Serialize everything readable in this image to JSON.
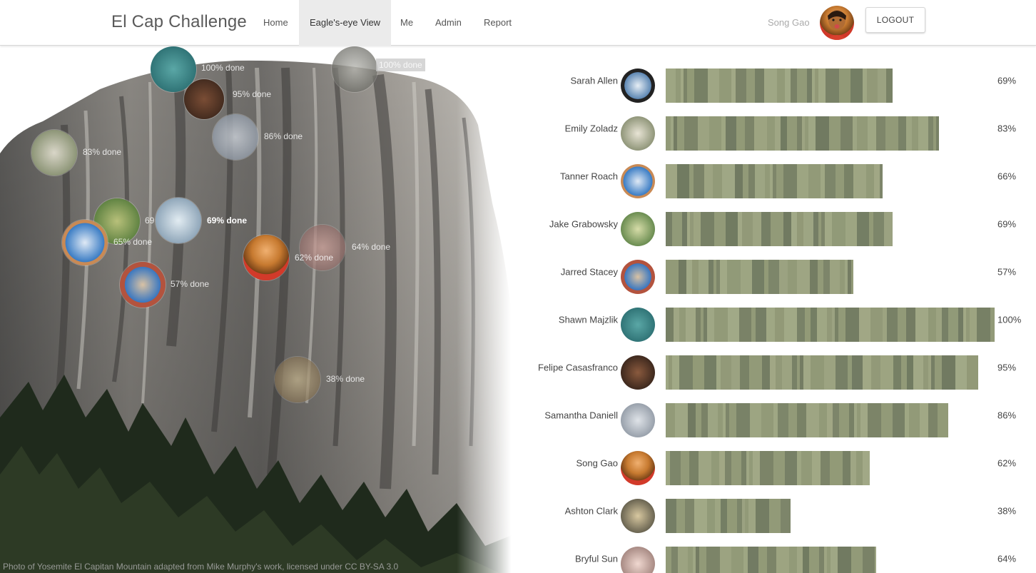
{
  "app": {
    "title": "El Cap Challenge"
  },
  "nav": {
    "items": [
      {
        "label": "Home",
        "active": false
      },
      {
        "label": "Eagle's-eye View",
        "active": true
      },
      {
        "label": "Me",
        "active": false
      },
      {
        "label": "Admin",
        "active": false
      },
      {
        "label": "Report",
        "active": false
      }
    ]
  },
  "user": {
    "name": "Song Gao",
    "logout_label": "LOGOUT"
  },
  "mountain": {
    "credit": "Photo of Yosemite El Capitan Mountain adapted from Mike Murphy's work, licensed under CC BY-SA 3.0",
    "markers": [
      {
        "label": "100% done"
      },
      {
        "label": "100% done"
      },
      {
        "label": "95% done"
      },
      {
        "label": "86% done"
      },
      {
        "label": "83% done"
      },
      {
        "label": "69"
      },
      {
        "label": "69% done"
      },
      {
        "label": "65% done"
      },
      {
        "label": "64% done"
      },
      {
        "label": "62% done"
      },
      {
        "label": "57% done"
      },
      {
        "label": "38% done"
      }
    ]
  },
  "leaderboard": [
    {
      "name": "Sarah Allen",
      "percent_label": "69%",
      "progress": 69
    },
    {
      "name": "Emily Zoladz",
      "percent_label": "83%",
      "progress": 83
    },
    {
      "name": "Tanner Roach",
      "percent_label": "66%",
      "progress": 66
    },
    {
      "name": "Jake Grabowsky",
      "percent_label": "69%",
      "progress": 69
    },
    {
      "name": "Jarred Stacey",
      "percent_label": "57%",
      "progress": 57
    },
    {
      "name": "Shawn Majzlik",
      "percent_label": "100%",
      "progress": 100
    },
    {
      "name": "Felipe Casasfranco",
      "percent_label": "95%",
      "progress": 95
    },
    {
      "name": "Samantha Daniell",
      "percent_label": "86%",
      "progress": 86
    },
    {
      "name": "Song Gao",
      "percent_label": "62%",
      "progress": 62
    },
    {
      "name": "Ashton Clark",
      "percent_label": "38%",
      "progress": 38
    },
    {
      "name": "Bryful Sun",
      "percent_label": "64%",
      "progress": 64
    }
  ],
  "colors": {
    "bar_base": "#929a78",
    "bar_dark": "#6f7860",
    "bar_light": "#a3aa88",
    "nav_active_bg": "#ebebeb"
  }
}
